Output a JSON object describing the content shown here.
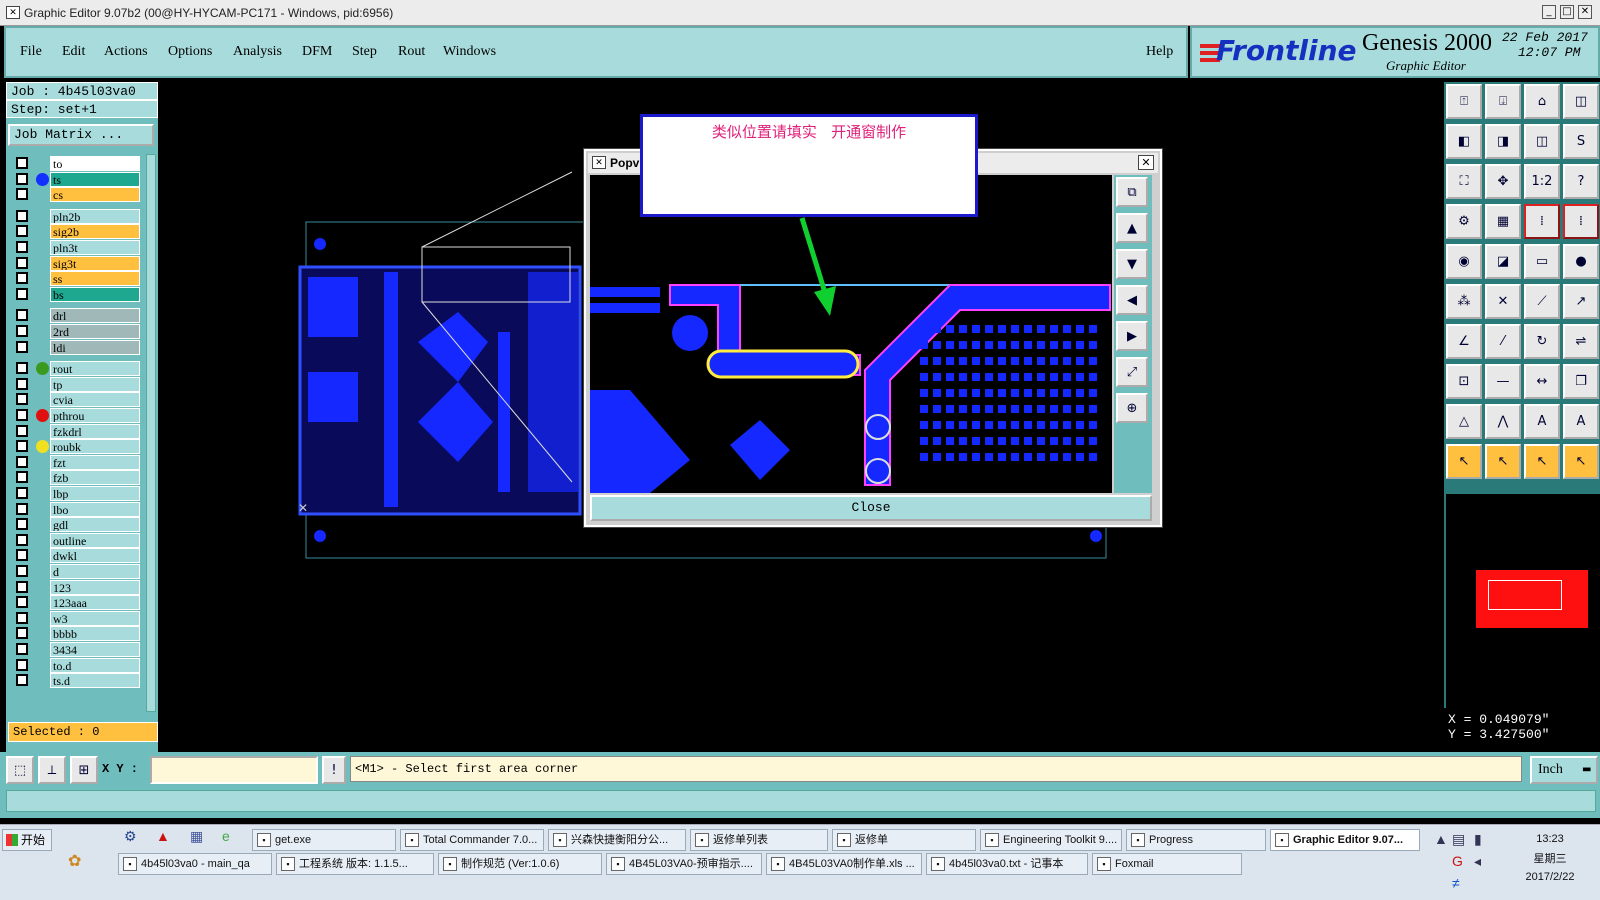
{
  "window": {
    "title": "Graphic Editor 9.07b2 (00@HY-HYCAM-PC171 - Windows, pid:6956)"
  },
  "menu": [
    "File",
    "Edit",
    "Actions",
    "Options",
    "Analysis",
    "DFM",
    "Step",
    "Rout",
    "Windows"
  ],
  "help": "Help",
  "logo": {
    "brand": "Frontline",
    "product": "Genesis 2000",
    "subtitle": "Graphic Editor",
    "date": "22 Feb 2017",
    "time": "12:07 PM"
  },
  "job": {
    "job": "Job : 4b45l03va0",
    "step": "Step: set+1",
    "matrix_button": "Job Matrix ..."
  },
  "layers": [
    {
      "name": "to",
      "color": "#ffffff",
      "dot": ""
    },
    {
      "name": "ts",
      "color": "#1fa890",
      "dot": "#1230ff"
    },
    {
      "name": "cs",
      "color": "#ffc040",
      "dot": ""
    },
    {
      "name": "pln2b",
      "color": "#a8dcdc",
      "dot": ""
    },
    {
      "name": "sig2b",
      "color": "#ffc040",
      "dot": ""
    },
    {
      "name": "pln3t",
      "color": "#a8dcdc",
      "dot": ""
    },
    {
      "name": "sig3t",
      "color": "#ffc040",
      "dot": ""
    },
    {
      "name": "ss",
      "color": "#ffc040",
      "dot": ""
    },
    {
      "name": "bs",
      "color": "#1fa890",
      "dot": ""
    },
    {
      "name": "drl",
      "color": "#a0b8b8",
      "dot": ""
    },
    {
      "name": "2rd",
      "color": "#a0b8b8",
      "dot": ""
    },
    {
      "name": "ldi",
      "color": "#a0b8b8",
      "dot": ""
    },
    {
      "name": "rout",
      "color": "#a8dcdc",
      "dot": "#3a9a20"
    },
    {
      "name": "tp",
      "color": "#a8dcdc",
      "dot": ""
    },
    {
      "name": "cvia",
      "color": "#a8dcdc",
      "dot": ""
    },
    {
      "name": "pthrou",
      "color": "#a8dcdc",
      "dot": "#e01010"
    },
    {
      "name": "fzkdrl",
      "color": "#a8dcdc",
      "dot": ""
    },
    {
      "name": "roubk",
      "color": "#a8dcdc",
      "dot": "#f0e020"
    },
    {
      "name": "fzt",
      "color": "#a8dcdc",
      "dot": ""
    },
    {
      "name": "fzb",
      "color": "#a8dcdc",
      "dot": ""
    },
    {
      "name": "lbp",
      "color": "#a8dcdc",
      "dot": ""
    },
    {
      "name": "lbo",
      "color": "#a8dcdc",
      "dot": ""
    },
    {
      "name": "gdl",
      "color": "#a8dcdc",
      "dot": ""
    },
    {
      "name": "outline",
      "color": "#a8dcdc",
      "dot": ""
    },
    {
      "name": "dwkl",
      "color": "#a8dcdc",
      "dot": ""
    },
    {
      "name": "d",
      "color": "#a8dcdc",
      "dot": ""
    },
    {
      "name": "123",
      "color": "#a8dcdc",
      "dot": ""
    },
    {
      "name": "123aaa",
      "color": "#a8dcdc",
      "dot": ""
    },
    {
      "name": "w3",
      "color": "#a8dcdc",
      "dot": ""
    },
    {
      "name": "bbbb",
      "color": "#a8dcdc",
      "dot": ""
    },
    {
      "name": "3434",
      "color": "#a8dcdc",
      "dot": ""
    },
    {
      "name": "to.d",
      "color": "#a8dcdc",
      "dot": ""
    },
    {
      "name": "ts.d",
      "color": "#a8dcdc",
      "dot": ""
    }
  ],
  "selected": "Selected : 0",
  "popup": {
    "title": "Popvi",
    "close_label": "Close"
  },
  "annotation": "类似位置请填实   开通窗制作",
  "coords": {
    "x": "X = 0.049079\"",
    "y": "Y = 3.427500\""
  },
  "xy_label": "X Y :",
  "xy_value": "",
  "prompt": "<M1> - Select first area corner",
  "units": "Inch",
  "taskbar": {
    "start": "开始",
    "row1": [
      "get.exe",
      "Total Commander 7.0...",
      "兴森快捷衡阳分公...",
      "返修单列表",
      "返修单",
      "Engineering Toolkit 9....",
      "Progress",
      "Graphic Editor 9.07..."
    ],
    "row2": [
      "4b45l03va0 - main_qa",
      "工程系统  版本: 1.1.5...",
      "制作规范 (Ver:1.0.6)",
      "4B45L03VA0-预审指示....",
      "4B45L03VA0制作单.xls ...",
      "4b45l03va0.txt - 记事本",
      "Foxmail"
    ],
    "clock_time": "13:23",
    "clock_day": "星期三",
    "clock_date": "2017/2/22"
  }
}
